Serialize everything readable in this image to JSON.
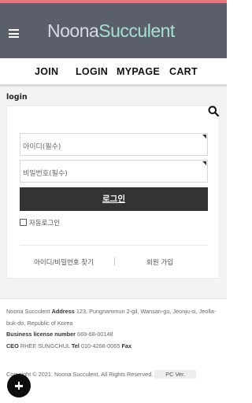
{
  "header": {
    "logo_part1": "Noona",
    "logo_part2": "Succulent",
    "menu_icon": "hamburger-icon",
    "accent_line_color": "#e8747c",
    "background_color": "#5b5f6b"
  },
  "nav": {
    "join": "JOIN",
    "login": "LOGIN",
    "mypage": "MYPAGE",
    "cart": "CART"
  },
  "login_page": {
    "title": "login",
    "search_icon": "search-icon",
    "id_placeholder": "아이디(필수)",
    "pw_placeholder": "비밀번호(필수)",
    "login_button": "로그인",
    "auto_login": "자동로그인",
    "find_account": "아이디/비밀번호 찾기",
    "join_member": "회원 가입"
  },
  "footer": {
    "company": "Noona Succulent",
    "address_label": "Address",
    "address": "123, Pungnammun 2-gil, Wansan-gu, Jeonju-si, Jeolla-buk-do, Republic of Korea",
    "license_label": "Business license number",
    "license": "669-68-00148",
    "ceo_label": "CEO",
    "ceo": "RHEE SUNGCHUL",
    "tel_label": "Tel",
    "tel": "010-4266-0065",
    "fax_label": "Fax",
    "copyright": "Copyright © 2021. Noona Succulent. All Rights Reserved.",
    "pc_version": "PC Ver."
  },
  "fab_icon": "plus-icon"
}
